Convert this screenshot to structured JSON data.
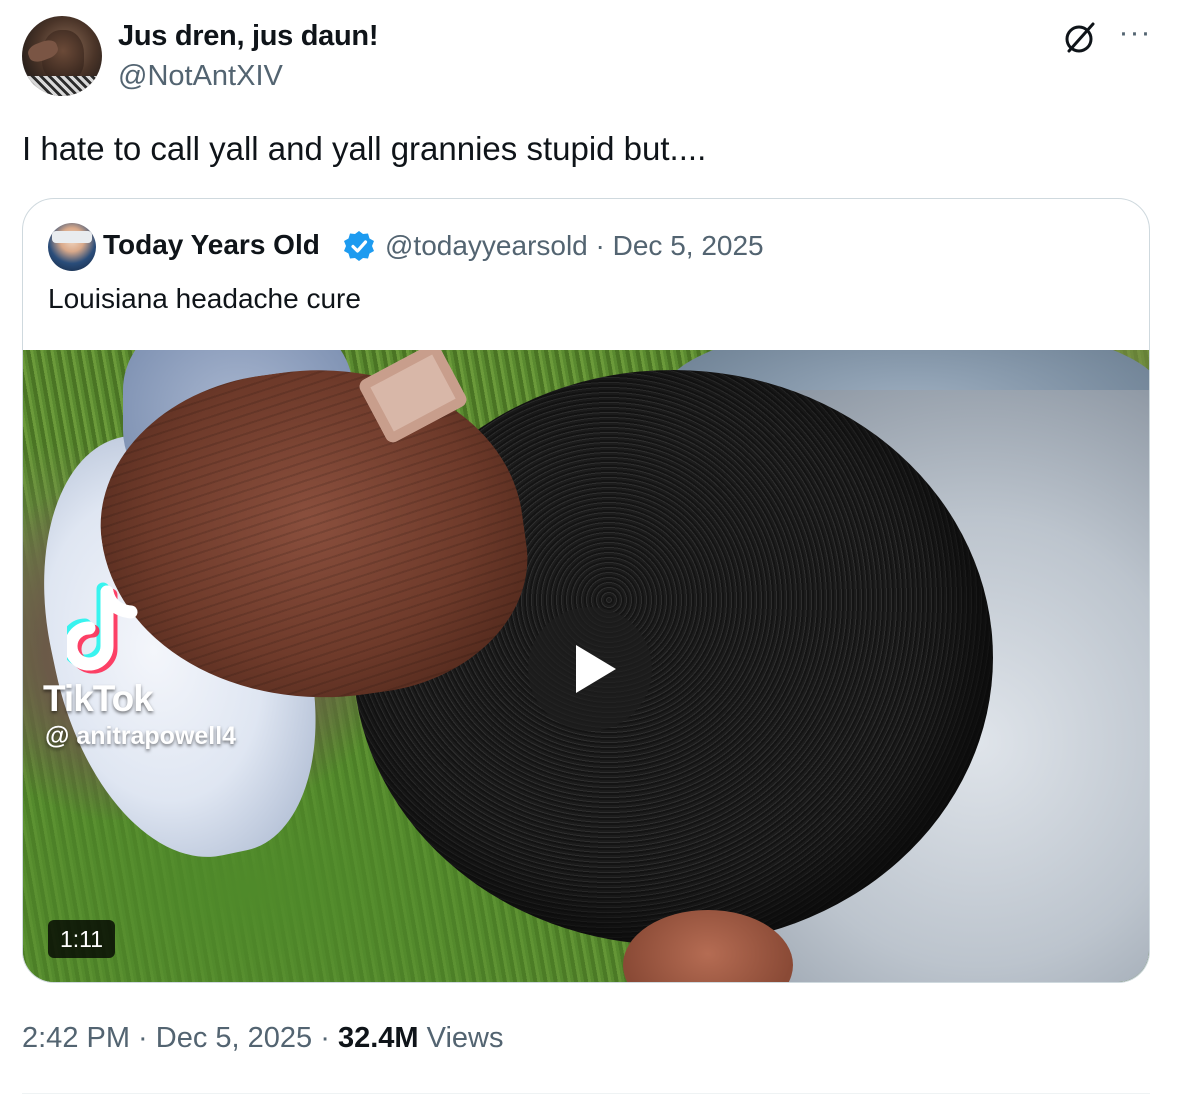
{
  "author": {
    "display_name": "Jus dren, jus daun!",
    "handle": "@NotAntXIV"
  },
  "header": {
    "grok_icon": "grok-icon",
    "more_icon": "more-options-icon",
    "more_glyph": "···"
  },
  "tweet": {
    "text": "I hate to call yall and yall grannies stupid but...."
  },
  "quote": {
    "display_name": "Today Years Old",
    "verified_icon": "verified-badge-icon",
    "verified_color": "#1d9bf0",
    "handle_date": "@todayyearsold · Dec 5, 2025",
    "text": "Louisiana headache cure",
    "media": {
      "watermark_brand": "TikTok",
      "watermark_user": "@ anitrapowell4",
      "duration": "1:11",
      "play_icon": "play-icon"
    }
  },
  "meta": {
    "time": "2:42 PM",
    "sep1": " · ",
    "date": "Dec 5, 2025",
    "sep2": " · ",
    "views_count": "32.4M",
    "views_label": " Views"
  }
}
